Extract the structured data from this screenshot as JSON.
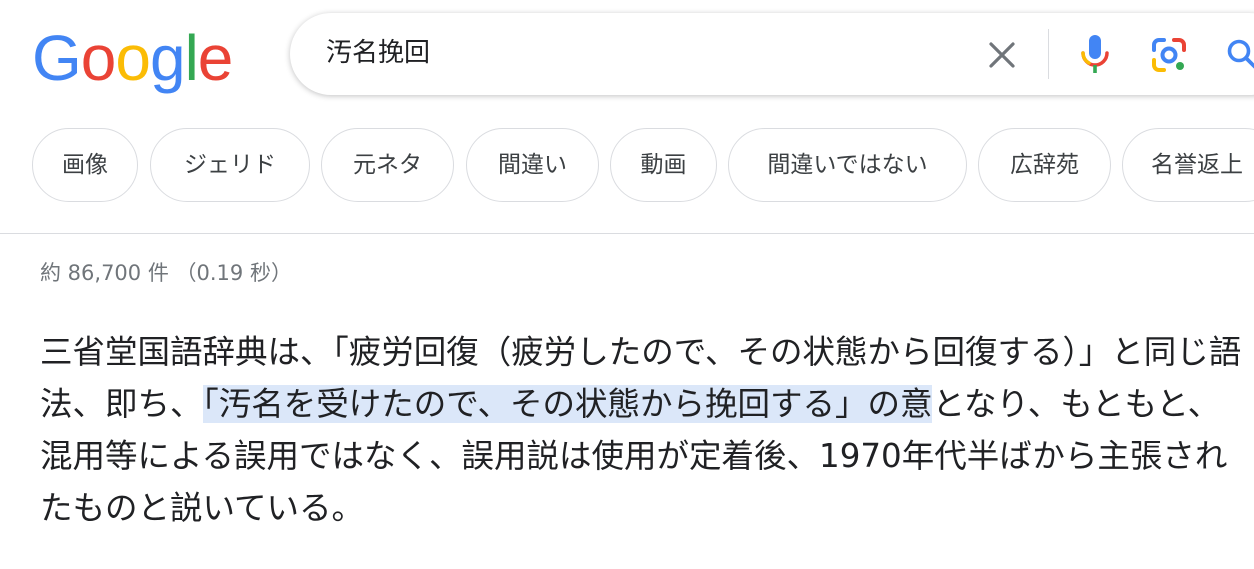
{
  "logo": {
    "letters": [
      "G",
      "o",
      "o",
      "g",
      "l",
      "e"
    ],
    "colors": [
      "#4285F4",
      "#EA4335",
      "#FBBC05",
      "#4285F4",
      "#34A853",
      "#EA4335"
    ]
  },
  "search": {
    "query": "汚名挽回",
    "clear_icon": "close-icon",
    "voice_icon": "mic-icon",
    "lens_icon": "camera-lens-icon",
    "search_icon": "magnifier-icon"
  },
  "chips": [
    "画像",
    "ジェリド",
    "元ネタ",
    "間違い",
    "動画",
    "間違いではない",
    "広辞苑",
    "名誉返上"
  ],
  "results": {
    "stats": "約 86,700 件 （0.19 秒）",
    "snippet": {
      "before": "三省堂国語辞典は、「疲労回復（疲労したので、その状態から回復する）」と同じ語法、即ち、",
      "highlight": "「汚名を受けたので、その状態から挽回する」の意",
      "after": "となり、もともと、混用等による誤用ではなく、誤用説は使用が定着後、1970年代半ばから主張されたものと説いている。"
    }
  },
  "colors": {
    "highlight": "#dbe7f9",
    "chip_border": "#dadce0",
    "stats_text": "#70757a"
  }
}
